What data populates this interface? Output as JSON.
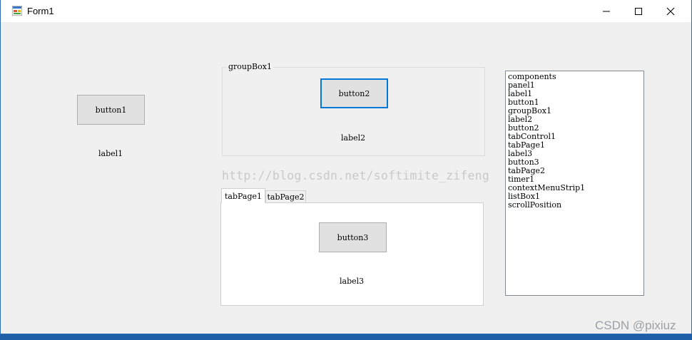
{
  "window": {
    "title": "Form1",
    "icon": "winforms-app-icon"
  },
  "controls": {
    "minimize": "minimize-icon",
    "maximize": "maximize-icon",
    "close": "close-icon"
  },
  "left": {
    "button1": "button1",
    "label1": "label1"
  },
  "groupbox": {
    "title": "groupBox1",
    "button2": "button2",
    "label2": "label2"
  },
  "watermark": "http://blog.csdn.net/softimite_zifeng",
  "tabs": [
    {
      "label": "tabPage1",
      "active": true
    },
    {
      "label": "tabPage2",
      "active": false
    }
  ],
  "tabpage1": {
    "button3": "button3",
    "label3": "label3"
  },
  "listbox": {
    "items": [
      "components",
      "panel1",
      "label1",
      "button1",
      "groupBox1",
      "label2",
      "button2",
      "tabControl1",
      "tabPage1",
      "label3",
      "button3",
      "tabPage2",
      "timer1",
      "contextMenuStrip1",
      "listBox1",
      "scrollPosition"
    ]
  },
  "corner_watermark": "CSDN @pixiuz",
  "colors": {
    "focus": "#0078d7",
    "taskbar": "#1f5fa8",
    "window_bg": "#f0f0f0"
  }
}
